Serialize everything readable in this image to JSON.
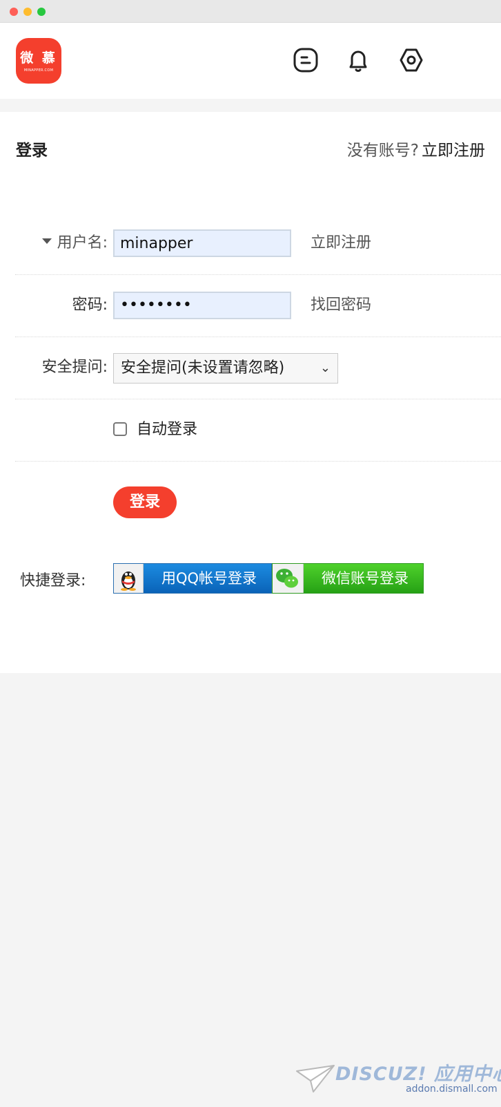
{
  "window": {
    "controls": [
      "close",
      "minimize",
      "zoom"
    ]
  },
  "header": {
    "logo": {
      "text": "微 慕",
      "subtext": "MINAPPER.COM"
    },
    "icons": [
      "message-icon",
      "bell-icon",
      "settings-icon"
    ]
  },
  "login": {
    "title": "登录",
    "no_account": "没有账号?",
    "register_link": "立即注册",
    "username": {
      "label": "用户名:",
      "value": "minapper",
      "side_link": "立即注册"
    },
    "password": {
      "label": "密码:",
      "value": "••••••••",
      "side_link": "找回密码"
    },
    "security": {
      "label": "安全提问:",
      "selected": "安全提问(未设置请忽略)"
    },
    "auto_login": {
      "label": "自动登录",
      "checked": false
    },
    "submit": "登录",
    "quick": {
      "label": "快捷登录:",
      "qq": "用QQ帐号登录",
      "wechat": "微信账号登录"
    }
  },
  "watermark": {
    "brand": "DISCUZ! 应用中心",
    "url": "addon.dismall.com"
  },
  "colors": {
    "accent": "#f43f2d",
    "qq_blue": "#0a63b8",
    "wechat_green": "#26a115"
  }
}
